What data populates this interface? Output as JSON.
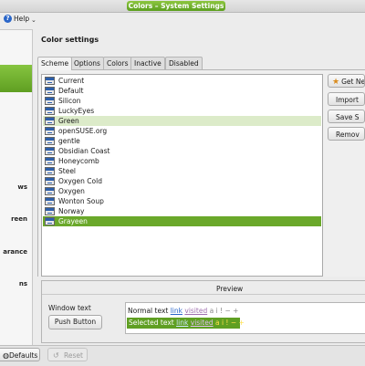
{
  "window": {
    "title": "Colors – System Settings"
  },
  "menubar": {
    "help_label": "Help",
    "help_icon": "?"
  },
  "sidebar": {
    "items": [
      {
        "label": "",
        "selected": true
      },
      {
        "label": "ws"
      },
      {
        "label": "reen"
      },
      {
        "label": "arance"
      },
      {
        "label": "ns"
      }
    ]
  },
  "main": {
    "section_title": "Color settings",
    "tabs": [
      {
        "label": "Scheme",
        "active": true
      },
      {
        "label": "Options"
      },
      {
        "label": "Colors"
      },
      {
        "label": "Inactive"
      },
      {
        "label": "Disabled"
      }
    ],
    "schemes": [
      {
        "name": "Current"
      },
      {
        "name": "Default"
      },
      {
        "name": "Silicon"
      },
      {
        "name": "LuckyEyes"
      },
      {
        "name": "Green",
        "state": "hover"
      },
      {
        "name": "openSUSE.org"
      },
      {
        "name": "gentle"
      },
      {
        "name": "Obsidian Coast"
      },
      {
        "name": "Honeycomb"
      },
      {
        "name": "Steel"
      },
      {
        "name": "Oxygen Cold"
      },
      {
        "name": "Oxygen"
      },
      {
        "name": "Wonton Soup"
      },
      {
        "name": "Norway"
      },
      {
        "name": "Grayeen",
        "state": "selected"
      }
    ],
    "buttons": {
      "get_new": "Get Ne",
      "import": "Import",
      "save": "Save S",
      "remove": "Remov"
    }
  },
  "preview": {
    "title": "Preview",
    "window_text": "Window text",
    "push_button": "Push Button",
    "normal_text": "Normal text",
    "link": "link",
    "visited": "visited",
    "normal_extra": "a i ! − +",
    "selected_text": "Selected text",
    "selected_extra": "a i ! − +"
  },
  "footer": {
    "defaults": "Defaults",
    "reset": "Reset"
  },
  "colors": {
    "accent": "#6aa82a",
    "hover_row": "#dcebc9",
    "link": "#2a66c9",
    "visited": "#a070b0"
  }
}
